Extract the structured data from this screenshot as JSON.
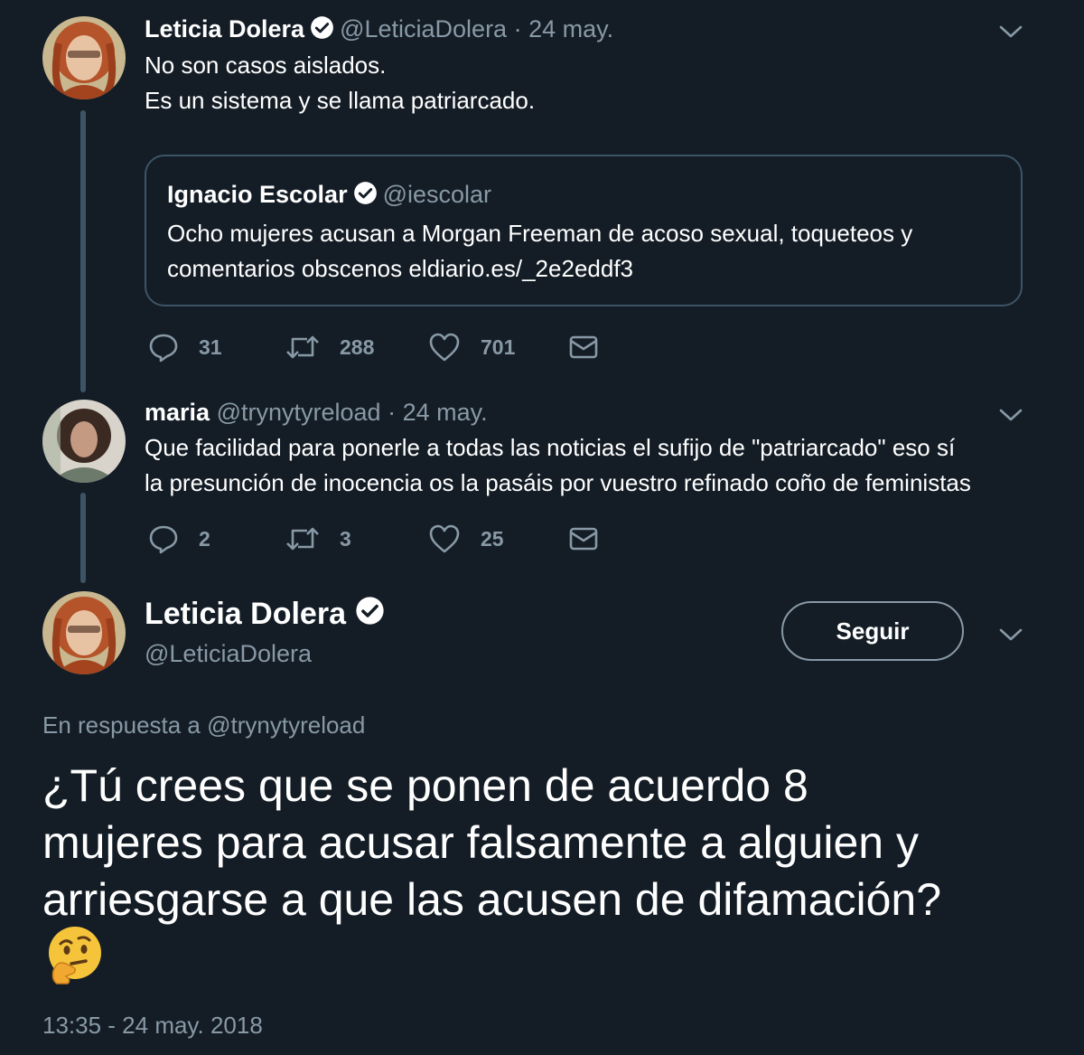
{
  "colors": {
    "background": "#141d26",
    "secondary_text": "#8899a6",
    "border": "#3d5466"
  },
  "tweet1": {
    "author_name": "Leticia Dolera",
    "handle": "@LeticiaDolera",
    "date": "· 24 may.",
    "text_lines": [
      "No son casos aislados.",
      "Es un sistema y se llama patriarcado."
    ],
    "quote": {
      "author_name": "Ignacio Escolar",
      "handle": "@iescolar",
      "text_lines": [
        "Ocho mujeres acusan a Morgan Freeman de acoso sexual, toqueteos y",
        "comentarios obscenos eldiario.es/_2e2eddf3"
      ]
    },
    "actions": {
      "replies": "31",
      "retweets": "288",
      "likes": "701"
    }
  },
  "tweet2": {
    "author_name": "maria",
    "handle": "@trynytyreload",
    "date": "· 24 may.",
    "text_lines": [
      "Que facilidad para ponerle a todas las noticias el sufijo de \"patriarcado\" eso sí",
      "la presunción de inocencia os la pasáis por vuestro refinado coño de feministas"
    ],
    "actions": {
      "replies": "2",
      "retweets": "3",
      "likes": "25"
    }
  },
  "main_tweet": {
    "author_name": "Leticia Dolera",
    "handle": "@LeticiaDolera",
    "follow_label": "Seguir",
    "reply_to": "En respuesta a @trynytyreload",
    "text_lines": [
      "¿Tú crees que se ponen de acuerdo 8",
      "mujeres para acusar falsamente a alguien y",
      "arriesgarse a que las acusen de difamación?"
    ],
    "emoji": "thinking-face",
    "timestamp": "13:35 - 24 may. 2018"
  }
}
